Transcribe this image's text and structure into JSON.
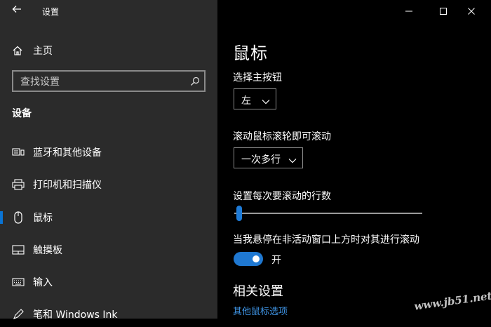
{
  "app": {
    "title": "设置"
  },
  "window": {
    "minimize_icon": "minimize-icon",
    "maximize_icon": "maximize-icon",
    "close_icon": "close-icon"
  },
  "sidebar": {
    "home_label": "主页",
    "search_placeholder": "查找设置",
    "section_title": "设备",
    "items": [
      {
        "label": "蓝牙和其他设备",
        "icon": "bluetooth-devices-icon"
      },
      {
        "label": "打印机和扫描仪",
        "icon": "printer-icon"
      },
      {
        "label": "鼠标",
        "icon": "mouse-icon",
        "selected": true
      },
      {
        "label": "触摸板",
        "icon": "touchpad-icon"
      },
      {
        "label": "输入",
        "icon": "keyboard-icon"
      },
      {
        "label": "笔和 Windows Ink",
        "icon": "pen-icon"
      }
    ]
  },
  "main": {
    "title": "鼠标",
    "primary_button": {
      "label": "选择主按钮",
      "value": "左"
    },
    "scroll_mode": {
      "label": "滚动鼠标滚轮即可滚动",
      "value": "一次多行"
    },
    "scroll_lines": {
      "label": "设置每次要滚动的行数",
      "value_fraction": 0.02
    },
    "inactive_scroll": {
      "label": "当我悬停在非活动窗口上方时对其进行滚动",
      "state": "开",
      "on": true
    },
    "related": {
      "title": "相关设置",
      "link": "其他鼠标选项"
    }
  },
  "watermark": "www.jb51.net",
  "colors": {
    "accent": "#0a74d4",
    "link": "#3f95e6",
    "sidebar_bg": "#2b2b2b",
    "main_bg": "#000000"
  }
}
